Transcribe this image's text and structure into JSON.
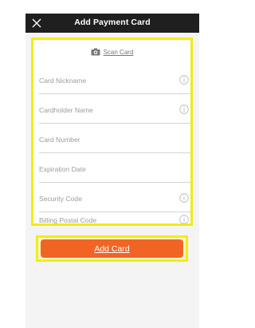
{
  "header": {
    "title": "Add Payment Card"
  },
  "scan": {
    "label": "Scan Card"
  },
  "fields": [
    {
      "label": "Card Nickname",
      "has_info_icon": true
    },
    {
      "label": "Cardholder Name",
      "has_info_icon": true
    },
    {
      "label": "Card Number",
      "has_info_icon": false
    },
    {
      "label": "Expiration Date",
      "has_info_icon": false
    },
    {
      "label": "Security Code",
      "has_info_icon": true
    },
    {
      "label": "Billing Postal Code",
      "has_info_icon": true
    }
  ],
  "actions": {
    "add_card_label": "Add Card"
  },
  "colors": {
    "header_bg": "#1f1f1f",
    "highlight": "#f2ec14",
    "button_bg": "#f26424",
    "label_text": "#9c9c9c"
  },
  "icons": {
    "close": "close-icon",
    "camera": "camera-icon",
    "info": "info-icon"
  }
}
